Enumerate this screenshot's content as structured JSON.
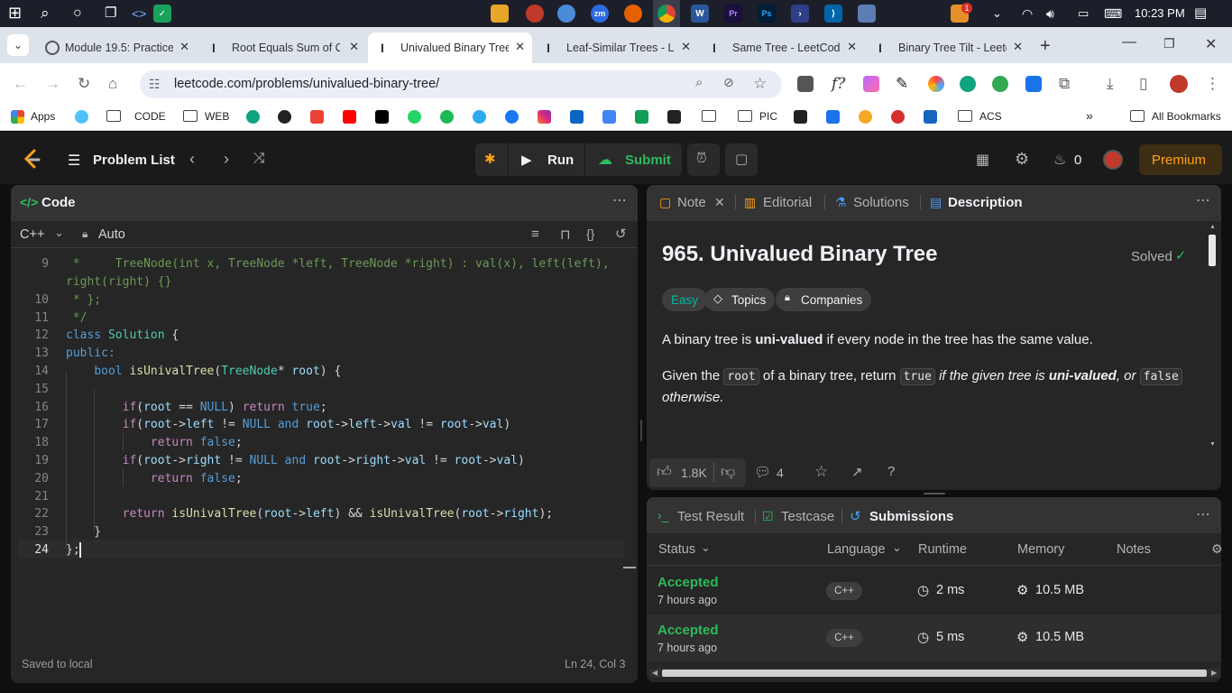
{
  "taskbar": {
    "time": "10:23 PM",
    "badge": "1"
  },
  "browser": {
    "tabs": [
      {
        "label": "Module 19.5: Practice"
      },
      {
        "label": "Root Equals Sum of C"
      },
      {
        "label": "Univalued Binary Tree"
      },
      {
        "label": "Leaf-Similar Trees - Le"
      },
      {
        "label": "Same Tree - LeetCode"
      },
      {
        "label": "Binary Tree Tilt - Leetc"
      }
    ],
    "url": "leetcode.com/problems/univalued-binary-tree/",
    "bookmarks": {
      "apps": "Apps",
      "code": "CODE",
      "web": "WEB",
      "pic": "PIC",
      "acs": "ACS",
      "all": "All Bookmarks"
    }
  },
  "header": {
    "problem_list": "Problem List",
    "run": "Run",
    "submit": "Submit",
    "streak": "0",
    "premium": "Premium"
  },
  "code_panel": {
    "title": "Code",
    "language": "C++",
    "mode": "Auto",
    "status": "Saved to local",
    "cursor": "Ln 24, Col 3"
  },
  "code_lines": [
    {
      "n": "9",
      "t": " *     TreeNode(int x, TreeNode *left, TreeNode *right) : val(x), left(left),"
    },
    {
      "n": "",
      "t": "right(right) {}"
    },
    {
      "n": "10",
      "t": " * };"
    },
    {
      "n": "11",
      "t": " */"
    },
    {
      "n": "12",
      "t": "class Solution {"
    },
    {
      "n": "13",
      "t": "public:"
    },
    {
      "n": "14",
      "t": "    bool isUnivalTree(TreeNode* root) {"
    },
    {
      "n": "15",
      "t": ""
    },
    {
      "n": "16",
      "t": "        if(root == NULL) return true;"
    },
    {
      "n": "17",
      "t": "        if(root->left != NULL and root->left->val != root->val)"
    },
    {
      "n": "18",
      "t": "            return false;"
    },
    {
      "n": "19",
      "t": "        if(root->right != NULL and root->right->val != root->val)"
    },
    {
      "n": "20",
      "t": "            return false;"
    },
    {
      "n": "21",
      "t": ""
    },
    {
      "n": "22",
      "t": "        return isUnivalTree(root->left) && isUnivalTree(root->right);"
    },
    {
      "n": "23",
      "t": "    }"
    },
    {
      "n": "24",
      "t": "};"
    }
  ],
  "desc_panel": {
    "tabs": {
      "note": "Note",
      "editorial": "Editorial",
      "solutions": "Solutions",
      "description": "Description"
    },
    "title": "965. Univalued Binary Tree",
    "solved": "Solved",
    "difficulty": "Easy",
    "topics": "Topics",
    "companies": "Companies",
    "p1_a": "A binary tree is ",
    "p1_b": "uni-valued",
    "p1_c": " if every node in the tree has the same value.",
    "p2_a": "Given the ",
    "p2_code1": "root",
    "p2_b": " of a binary tree, return ",
    "p2_code2": "true",
    "p2_c": " if the given tree is ",
    "p2_d": "uni-valued",
    "p2_e": ", or ",
    "p2_code3": "false",
    "p2_f": "otherwise.",
    "likes": "1.8K",
    "comments": "4"
  },
  "result_panel": {
    "tabs": {
      "test_result": "Test Result",
      "testcase": "Testcase",
      "submissions": "Submissions"
    },
    "columns": {
      "status": "Status",
      "language": "Language",
      "runtime": "Runtime",
      "memory": "Memory",
      "notes": "Notes"
    },
    "rows": [
      {
        "status": "Accepted",
        "ago": "7 hours ago",
        "lang": "C++",
        "runtime": "2 ms",
        "memory": "10.5 MB"
      },
      {
        "status": "Accepted",
        "ago": "7 hours ago",
        "lang": "C++",
        "runtime": "5 ms",
        "memory": "10.5 MB"
      }
    ]
  }
}
